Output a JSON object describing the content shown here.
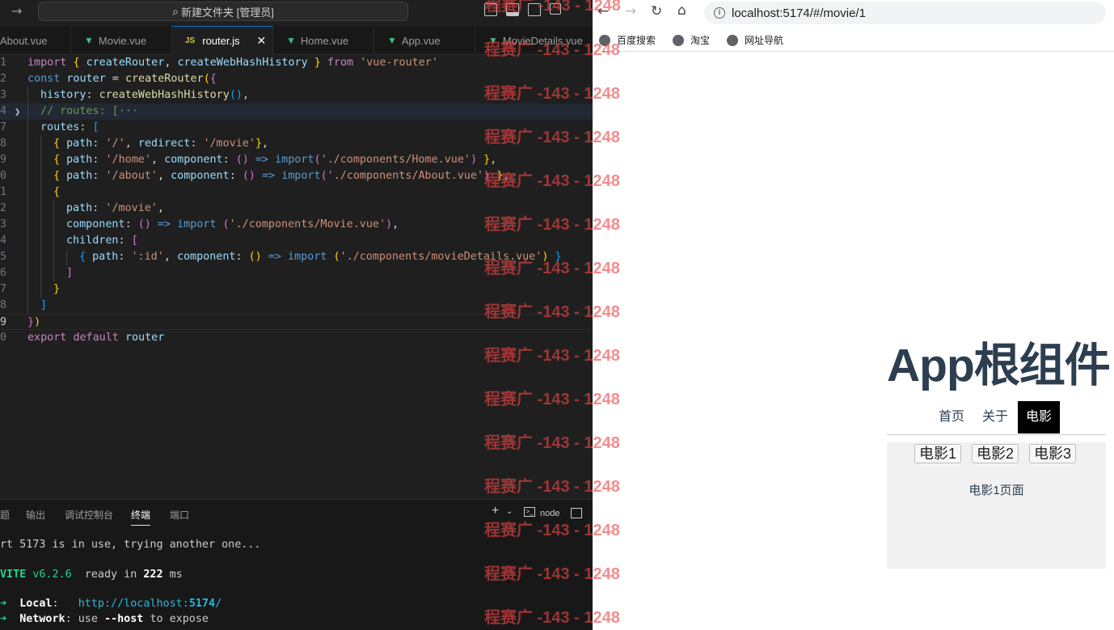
{
  "vscode": {
    "search": "新建文件夹 [管理员]",
    "tabs": [
      {
        "label": "About.vue",
        "icon": "vue-icon"
      },
      {
        "label": "Movie.vue",
        "icon": "vue-icon"
      },
      {
        "label": "router.js",
        "icon": "js-icon",
        "active": true,
        "badge": "JS"
      },
      {
        "label": "Home.vue",
        "icon": "vue-icon"
      },
      {
        "label": "App.vue",
        "icon": "vue-icon"
      },
      {
        "label": "MovieDetails.vue",
        "icon": "vue-icon"
      }
    ],
    "close_glyph": "✕",
    "line_numbers": [
      "1",
      "2",
      "3",
      "4",
      "7",
      "8",
      "9",
      "0",
      "1",
      "2",
      "3",
      "4",
      "5",
      "6",
      "7",
      "8",
      "9",
      "0"
    ],
    "code_lines": [
      "import { createRouter, createWebHashHistory } from 'vue-router'",
      "const router = createRouter({",
      "  history: createWebHashHistory(),",
      "  // routes: [···",
      "  routes: [",
      "    { path: '/', redirect: '/movie'},",
      "    { path: '/home', component: () => import('./components/Home.vue') },",
      "    { path: '/about', component: () => import('./components/About.vue') },",
      "    {",
      "      path: '/movie',",
      "      component: () => import ('./components/Movie.vue'),",
      "      children: [",
      "        { path: ':id', component: () => import ('./components/movieDetails.vue') }",
      "      ]",
      "    }",
      "  ]",
      "})",
      "export default router"
    ],
    "panel_tabs": [
      "题",
      "输出",
      "调试控制台",
      "终端",
      "端口"
    ],
    "panel_active": "终端",
    "panel_actions": {
      "add": "+",
      "shell": "node"
    },
    "terminal": {
      "line1": "rt 5173 is in use, trying another one...",
      "vite_name": "VITE",
      "vite_version": "v6.2.6",
      "ready_text": "ready in",
      "ready_ms": "222",
      "ready_unit": "ms",
      "arrow": "➜",
      "local_label": "Local",
      "local_url_prefix": "http://localhost:",
      "local_port": "5174",
      "local_url_suffix": "/",
      "network_label": "Network",
      "network_text1": "use",
      "network_flag": "--host",
      "network_text2": "to expose"
    }
  },
  "browser": {
    "url": "localhost:5174/#/movie/1",
    "bookmarks": [
      "百度搜索",
      "淘宝",
      "网址导航"
    ],
    "app": {
      "title": "App根组件",
      "nav": [
        "首页",
        "关于",
        "电影"
      ],
      "nav_active": "电影",
      "movies": [
        "电影1",
        "电影2",
        "电影3"
      ],
      "detail": "电影1页面"
    }
  },
  "watermark": "程赛广 -143 - 1248",
  "watermark_top": "程赛广 -143 - 1248"
}
